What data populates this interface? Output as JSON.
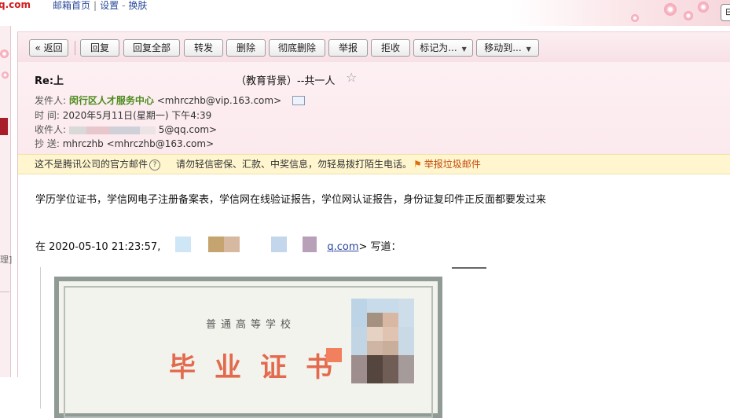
{
  "header": {
    "brand_tail": "q.com",
    "links": [
      "邮箱首页",
      "设置",
      "换肤"
    ],
    "separators": [
      "|",
      "-"
    ]
  },
  "toolbar": {
    "back": "« 返回",
    "reply": "回复",
    "reply_all": "回复全部",
    "forward": "转发",
    "delete": "删除",
    "delete_permanently": "彻底删除",
    "report": "举报",
    "reject": "拒收",
    "mark_as": "标记为...",
    "move_to": "移动到..."
  },
  "mail": {
    "subject": "Re:上",
    "subject_tail": "（教育背景）--共一人",
    "from_label": "发件人:",
    "from_name": "闵行区人才服务中心",
    "from_email": "<mhrczhb@vip.163.com>",
    "time_label": "时   间:",
    "time_value": "2020年5月11日(星期一) 下午4:39",
    "to_label": "收件人:",
    "to_value": "5@qq.com>",
    "cc_label": "抄   送:",
    "cc_value": "mhrczhb <mhrczhb@163.com>"
  },
  "warning": {
    "text1": "这不是腾讯公司的官方邮件",
    "text2": "请勿轻信密保、汇款、中奖信息，勿轻易拨打陌生电话。",
    "report_link": "举报垃圾邮件"
  },
  "body": {
    "line1": "学历学位证书，学信网电子注册备案表，学信网在线验证报告，学位网认证报告，身份证复印件正反面都要发过来",
    "quote_prefix": "在 2020-05-10 21:23:57,",
    "quote_email": "q.com",
    "quote_suffix": "> 写道："
  },
  "certificate": {
    "school": "普通高等学校",
    "title": "毕业证书"
  },
  "colors": {
    "accent_red": "#a71d2a",
    "sender_green": "#4b8a1b",
    "warning_bg": "#fff6cf",
    "cert_red": "#e36a4c"
  }
}
